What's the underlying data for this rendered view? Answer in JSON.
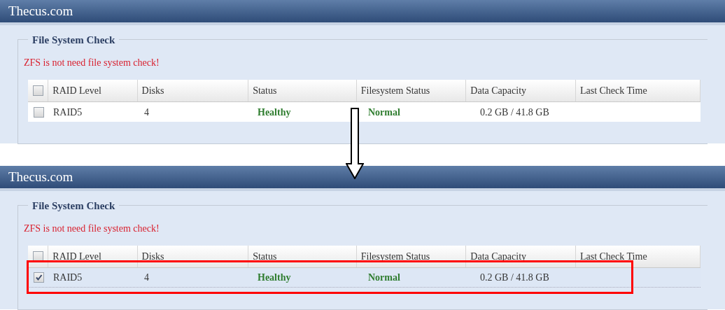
{
  "screens": [
    {
      "title": "Thecus.com",
      "section_title": "File System Check",
      "message": "ZFS is not need file system check!",
      "columns": [
        "RAID Level",
        "Disks",
        "Status",
        "Filesystem Status",
        "Data Capacity",
        "Last Check Time"
      ],
      "header_checked": false,
      "rows": [
        {
          "checked": false,
          "selected": false,
          "highlighted": false,
          "raid_level": "RAID5",
          "disks": "4",
          "status": "Healthy",
          "filesystem_status": "Normal",
          "data_capacity": "0.2 GB / 41.8 GB"
        }
      ]
    },
    {
      "title": "Thecus.com",
      "section_title": "File System Check",
      "message": "ZFS is not need file system check!",
      "columns": [
        "RAID Level",
        "Disks",
        "Status",
        "Filesystem Status",
        "Data Capacity",
        "Last Check Time"
      ],
      "header_checked": false,
      "rows": [
        {
          "checked": true,
          "selected": true,
          "highlighted": true,
          "raid_level": "RAID5",
          "disks": "4",
          "status": "Healthy",
          "filesystem_status": "Normal",
          "data_capacity": "0.2 GB / 41.8 GB"
        }
      ]
    }
  ]
}
